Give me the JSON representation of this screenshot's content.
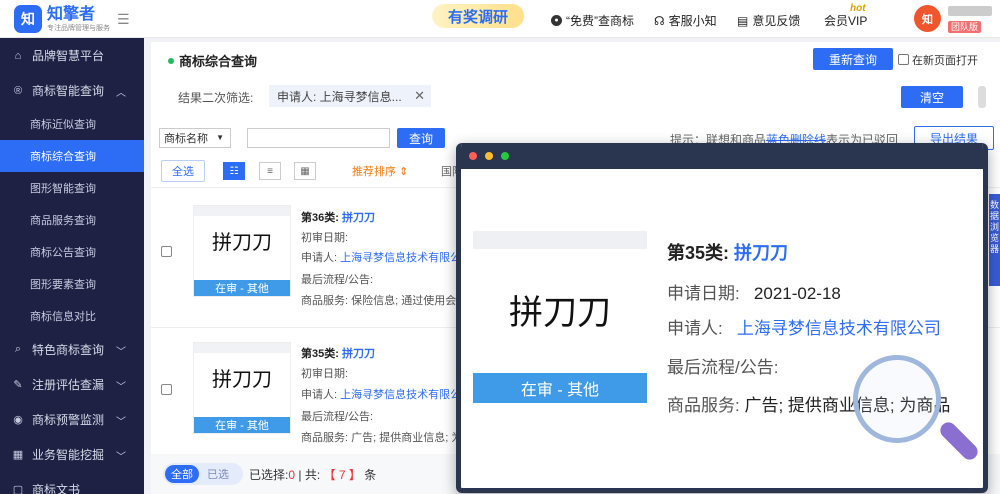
{
  "header": {
    "logo_mark": "知",
    "logo_name": "知擎者",
    "logo_sub": "专注品牌管理与服务",
    "promo": "有奖调研",
    "nav": [
      "“免费”查商标",
      "客服小知",
      "意见反馈",
      "会员VIP"
    ],
    "hot": "hot",
    "avatar": "知",
    "team": "团队版"
  },
  "sidebar": {
    "items": [
      {
        "label": "品牌智慧平台",
        "icon": "home-icon"
      },
      {
        "label": "商标智能查询",
        "icon": "trademark-icon"
      },
      {
        "label": "特色商标查询",
        "icon": "search-icon"
      },
      {
        "label": "注册评估查漏",
        "icon": "edit-icon"
      },
      {
        "label": "商标预警监测",
        "icon": "monitor-icon"
      },
      {
        "label": "业务智能挖掘",
        "icon": "layers-icon"
      },
      {
        "label": "商标文书"
      }
    ],
    "sub": [
      "商标近似查询",
      "商标综合查询",
      "图形智能查询",
      "商品服务查询",
      "商标公告查询",
      "图形要素查询",
      "商标信息对比"
    ]
  },
  "main": {
    "title": "商标综合查询",
    "requery": "重新查询",
    "new_page": "在新页面打开",
    "filter_label": "结果二次筛选:",
    "tag": "申请人:  上海寻梦信息...",
    "clear": "清空",
    "select": "商标名称",
    "search_btn": "查询",
    "tip_a": "提示：联想和商品",
    "tip_b": "蓝色删除线",
    "tip_c": "表示为已驳回",
    "export": "导出结果",
    "select_all": "全选",
    "sort": "推荐排序",
    "region": "国际"
  },
  "cards": [
    {
      "cls": "第36类:",
      "name": "拼刀刀",
      "mark": "拼刀刀",
      "status": "在审 - 其他",
      "date_label": "初审日期:",
      "applicant_label": "申请人:",
      "applicant": "上海寻梦信息技术有限公",
      "flow": "最后流程/公告:",
      "goods_label": "商品服务:",
      "goods": "保险信息; 通过使用会员"
    },
    {
      "cls": "第35类:",
      "name": "拼刀刀",
      "mark": "拼刀刀",
      "status": "在审 - 其他",
      "date_label": "初审日期:",
      "applicant_label": "申请人:",
      "applicant": "上海寻梦信息技术有限公",
      "flow": "最后流程/公告:",
      "goods_label": "商品服务:",
      "goods": "广告; 提供商业信息; 为"
    }
  ],
  "footer": {
    "all": "全部",
    "selected": "已选",
    "sel_label": "已选择:",
    "sel_count": "0",
    "sep": "| 共:",
    "total": "【 7 】",
    "unit": "条"
  },
  "popup": {
    "cls": "第35类:",
    "name": "拼刀刀",
    "mark": "拼刀刀",
    "status": "在审 - 其他",
    "date_label": "申请日期:",
    "date": "2021-02-18",
    "applicant_label": "申请人:",
    "applicant": "上海寻梦信息技术有限公司",
    "flow": "最后流程/公告:",
    "goods_label": "商品服务:",
    "goods": "广告; 提供商业信息; 为商品"
  },
  "right_tab": "数据浏览器"
}
